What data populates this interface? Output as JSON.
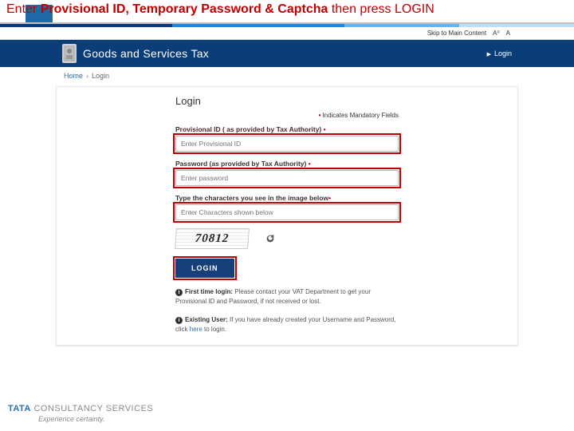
{
  "instruction": {
    "prefix": "Enter ",
    "bold": "Provisional ID, Temporary Password & Captcha",
    "suffix": " then press LOGIN"
  },
  "topbar": {
    "skip": "Skip to Main Content",
    "a_sup": "A⁰",
    "a": "A"
  },
  "header": {
    "brand": "Goods and Services Tax",
    "login_link": "Login"
  },
  "crumbs": {
    "home": "Home",
    "current": "Login"
  },
  "form": {
    "title": "Login",
    "mandatory": "Indicates Mandatory Fields",
    "provisional_label": "Provisional ID ( as provided by Tax Authority)",
    "provisional_placeholder": "Enter Provisional ID",
    "password_label": "Password (as provided by Tax Authority)",
    "password_placeholder": "Enter password",
    "captcha_label": "Type the characters you see in the image below",
    "captcha_placeholder": "Enter Characters shown below",
    "captcha_text": "70812",
    "login_button": "LOGIN"
  },
  "notes": {
    "first_bold": "First time login:",
    "first_text": " Please contact your VAT Department to get your Provisional ID and Password, if not received or lost.",
    "existing_bold": "Existing User:",
    "existing_pre": " If you have already created your Username and Password, click ",
    "existing_link": "here",
    "existing_post": " to login."
  },
  "footer": {
    "tata": "TATA",
    "cs": " CONSULTANCY SERVICES",
    "tag": "Experience certainty."
  }
}
